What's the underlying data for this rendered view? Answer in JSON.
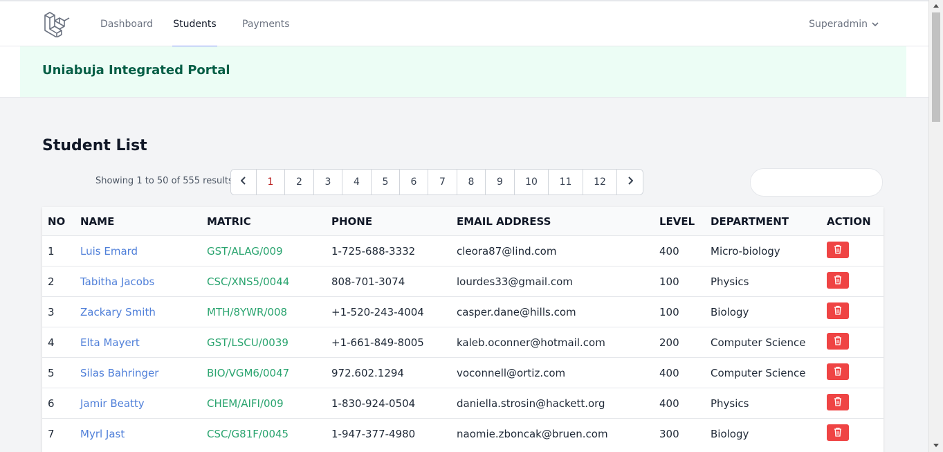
{
  "nav": {
    "links": [
      {
        "label": "Dashboard"
      },
      {
        "label": "Students"
      },
      {
        "label": "Payments"
      }
    ],
    "user": "Superadmin"
  },
  "header": {
    "title": "Uniabuja Integrated Portal"
  },
  "section": {
    "title": "Student List"
  },
  "pagination": {
    "summary": "Showing 1 to 50 of 555 results",
    "pages": [
      "1",
      "2",
      "3",
      "4",
      "5",
      "6",
      "7",
      "8",
      "9",
      "10",
      "11",
      "12"
    ],
    "current": "1"
  },
  "table": {
    "headers": [
      "NO",
      "NAME",
      "MATRIC",
      "PHONE",
      "EMAIL ADDRESS",
      "LEVEL",
      "DEPARTMENT",
      "ACTION"
    ],
    "rows": [
      {
        "no": "1",
        "name": "Luis Emard",
        "matric": "GST/ALAG/009",
        "phone": "1-725-688-3332",
        "email": "cleora87@lind.com",
        "level": "400",
        "department": "Micro-biology"
      },
      {
        "no": "2",
        "name": "Tabitha Jacobs",
        "matric": "CSC/XNS5/0044",
        "phone": "808-701-3074",
        "email": "lourdes33@gmail.com",
        "level": "100",
        "department": "Physics"
      },
      {
        "no": "3",
        "name": "Zackary Smith",
        "matric": "MTH/8YWR/008",
        "phone": "+1-520-243-4004",
        "email": "casper.dane@hills.com",
        "level": "100",
        "department": "Biology"
      },
      {
        "no": "4",
        "name": "Elta Mayert",
        "matric": "GST/LSCU/0039",
        "phone": "+1-661-849-8005",
        "email": "kaleb.oconner@hotmail.com",
        "level": "200",
        "department": "Computer Science"
      },
      {
        "no": "5",
        "name": "Silas Bahringer",
        "matric": "BIO/VGM6/0047",
        "phone": "972.602.1294",
        "email": "voconnell@ortiz.com",
        "level": "400",
        "department": "Computer Science"
      },
      {
        "no": "6",
        "name": "Jamir Beatty",
        "matric": "CHEM/AIFI/009",
        "phone": "1-830-924-0504",
        "email": "daniella.strosin@hackett.org",
        "level": "400",
        "department": "Physics"
      },
      {
        "no": "7",
        "name": "Myrl Jast",
        "matric": "CSC/G81F/0045",
        "phone": "1-947-377-4980",
        "email": "naomie.zboncak@bruen.com",
        "level": "300",
        "department": "Biology"
      }
    ]
  },
  "icons": {
    "logo": "laravel-logo-icon",
    "delete": "trash-icon",
    "user_menu": "chevron-down-icon",
    "prev": "chevron-left-icon",
    "next": "chevron-right-icon"
  },
  "colors": {
    "accent": "#818cf8",
    "header_bg": "#ecfdf5",
    "header_text": "#065f46",
    "name_link": "#4f7fd9",
    "matric_text": "#2aa46f",
    "delete_button": "#ef4444"
  }
}
